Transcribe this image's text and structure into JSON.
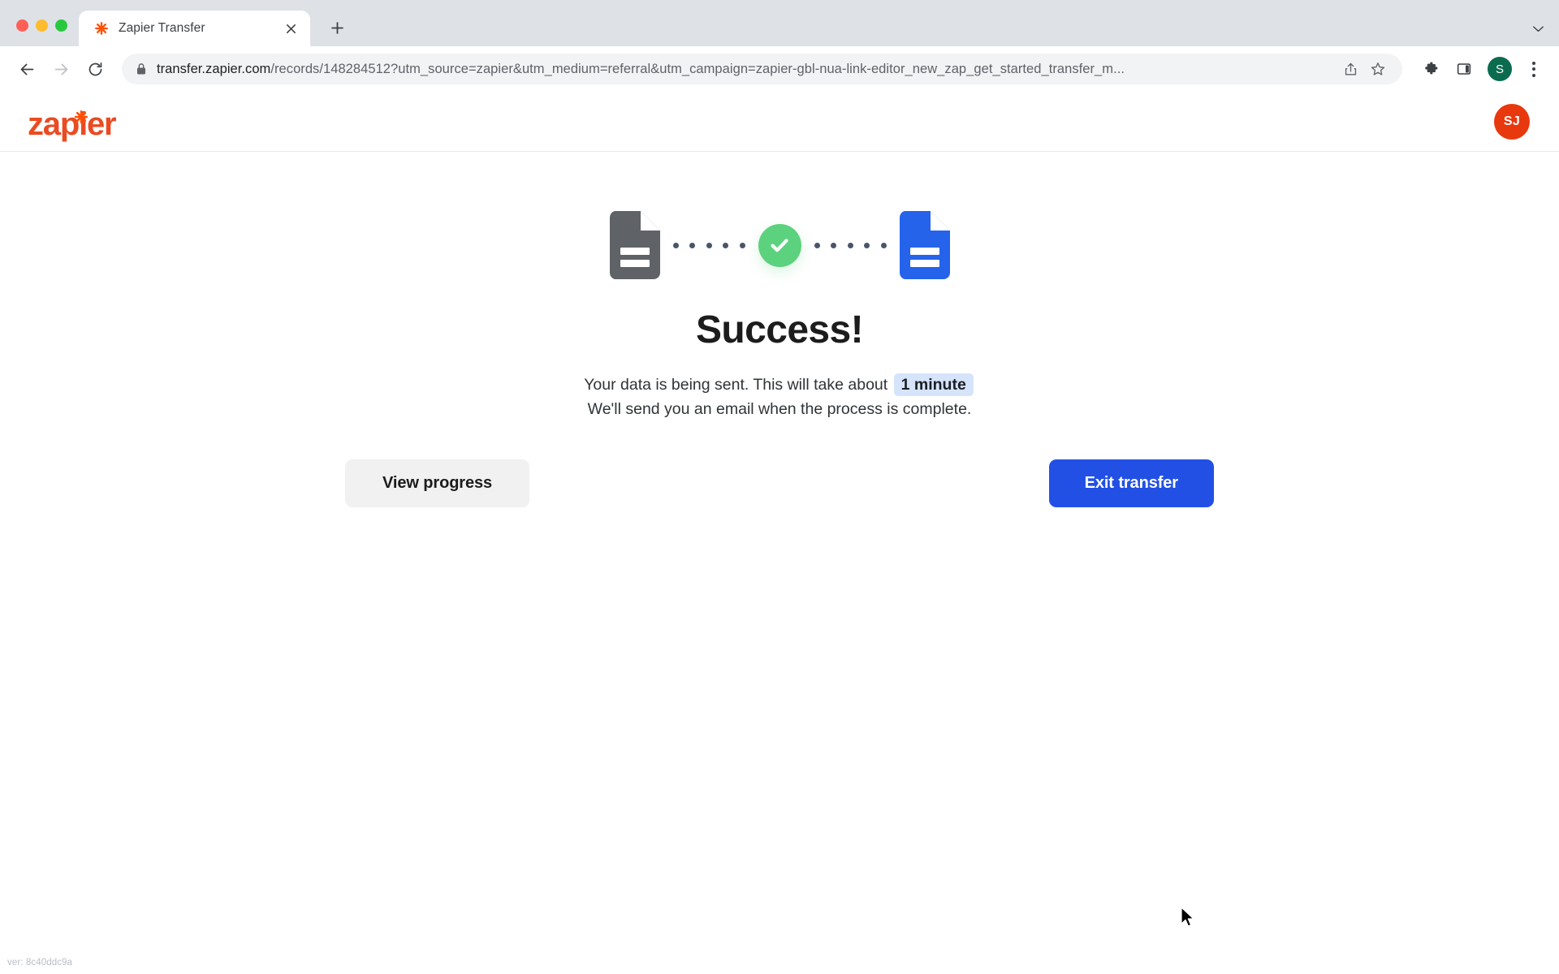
{
  "browser": {
    "tab": {
      "title": "Zapier Transfer",
      "favicon_icon": "zapier-asterisk-icon",
      "close_icon": "close-icon"
    },
    "new_tab_icon": "plus-icon",
    "tabstrip_menu_icon": "chevron-down-icon",
    "nav": {
      "back_icon": "back-arrow-icon",
      "forward_icon": "forward-arrow-icon",
      "reload_icon": "reload-icon"
    },
    "omnibox": {
      "lock_icon": "lock-icon",
      "url_host": "transfer.zapier.com",
      "url_path": "/records/148284512?utm_source=zapier&utm_medium=referral&utm_campaign=zapier-gbl-nua-link-editor_new_zap_get_started_transfer_m...",
      "share_icon": "share-icon",
      "bookmark_icon": "star-icon"
    },
    "toolbar_right": {
      "extensions_icon": "puzzle-piece-icon",
      "side_panel_icon": "side-panel-icon",
      "profile_initial": "S",
      "menu_icon": "three-dot-menu-icon"
    }
  },
  "app": {
    "logo_text": "zapier",
    "logo_asterisk_icon": "zapier-asterisk-icon",
    "avatar_initials": "SJ",
    "colors": {
      "brand_orange": "#ea4b22",
      "avatar_red": "#e8380d",
      "primary_blue": "#2250e5",
      "success_green": "#5cd27e",
      "source_doc_gray": "#5f6368",
      "dest_doc_blue": "#2563eb",
      "chip_blue_bg": "#d6e4fb"
    },
    "graphic": {
      "source_icon": "source-document-icon",
      "check_icon": "check-circle-icon",
      "destination_icon": "destination-document-icon"
    },
    "headline": "Success!",
    "subtext_line1_before": "Your data is being sent. This will take about",
    "subtext_time_chip": "1 minute",
    "subtext_line2": "We'll send you an email when the process is complete.",
    "buttons": {
      "view_progress": "View progress",
      "exit_transfer": "Exit transfer"
    },
    "version": "ver: 8c40ddc9a"
  }
}
